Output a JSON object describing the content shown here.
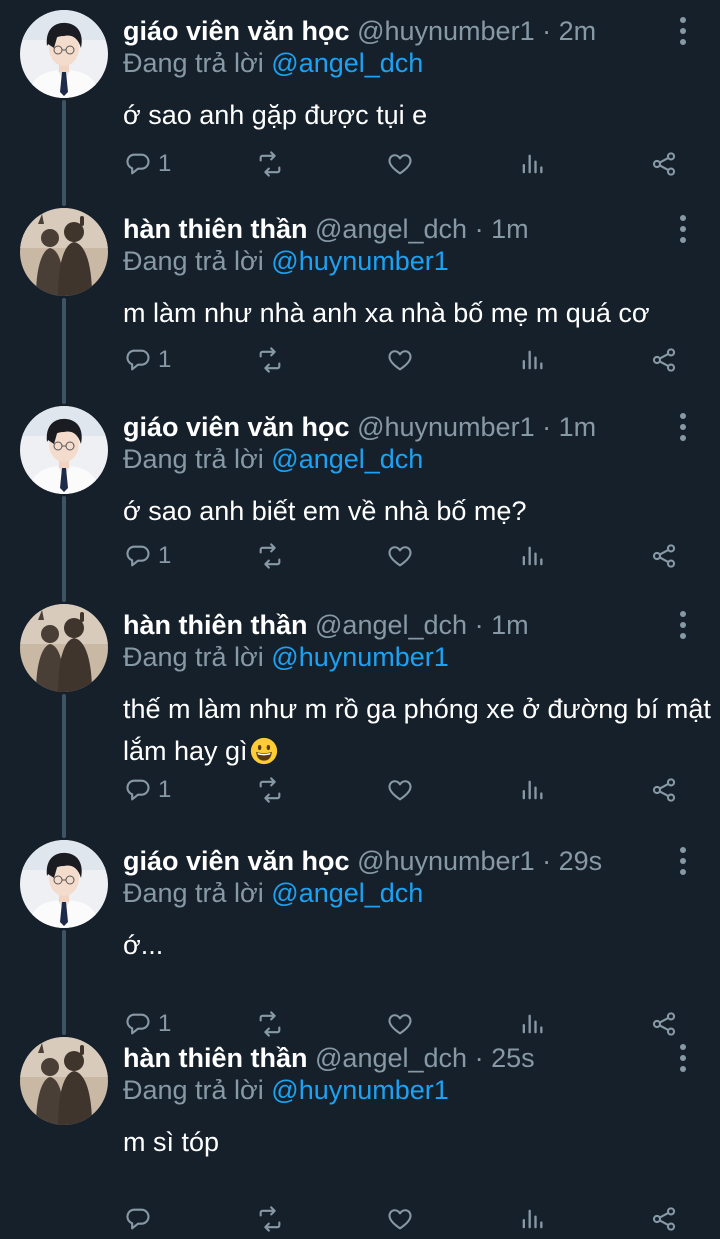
{
  "reply_prefix": "Đang trả lời",
  "colors": {
    "background": "#15202b",
    "secondary_text": "#8899a6",
    "link": "#1da1f2",
    "thread_line": "#3d5466"
  },
  "icons": {
    "reply": "reply-icon",
    "retweet": "retweet-icon",
    "like": "heart-icon",
    "analytics": "analytics-icon",
    "share": "share-icon",
    "more": "more-vertical-icon"
  },
  "tweets": [
    {
      "name": "giáo viên văn học",
      "handle": "@huynumber1",
      "separator": "·",
      "time": "2m",
      "reply_to": "@angel_dch",
      "text": "ớ sao anh gặp được tụi e",
      "reply_count": "1",
      "avatar": "boy"
    },
    {
      "name": "hàn thiên thần",
      "handle": "@angel_dch",
      "separator": "·",
      "time": "1m",
      "reply_to": "@huynumber1",
      "text": "m làm như nhà anh xa nhà bố mẹ m quá cơ",
      "reply_count": "1",
      "avatar": "shadow"
    },
    {
      "name": "giáo viên văn học",
      "handle": "@huynumber1",
      "separator": "·",
      "time": "1m",
      "reply_to": "@angel_dch",
      "text": "ớ sao anh biết em về nhà bố mẹ?",
      "reply_count": "1",
      "avatar": "boy"
    },
    {
      "name": "hàn thiên thần",
      "handle": "@angel_dch",
      "separator": "·",
      "time": "1m",
      "reply_to": "@huynumber1",
      "text": "thế m làm như m rồ ga phóng xe ở đường bí mật lắm hay gì",
      "reply_count": "1",
      "avatar": "shadow",
      "emoji": "grinning-face-emoji"
    },
    {
      "name": "giáo viên văn học",
      "handle": "@huynumber1",
      "separator": "·",
      "time": "29s",
      "reply_to": "@angel_dch",
      "text": "ớ...",
      "reply_count": "1",
      "avatar": "boy"
    },
    {
      "name": "hàn thiên thần",
      "handle": "@angel_dch",
      "separator": "·",
      "time": "25s",
      "reply_to": "@huynumber1",
      "text": "m sì tóp",
      "reply_count": "",
      "avatar": "shadow"
    }
  ]
}
